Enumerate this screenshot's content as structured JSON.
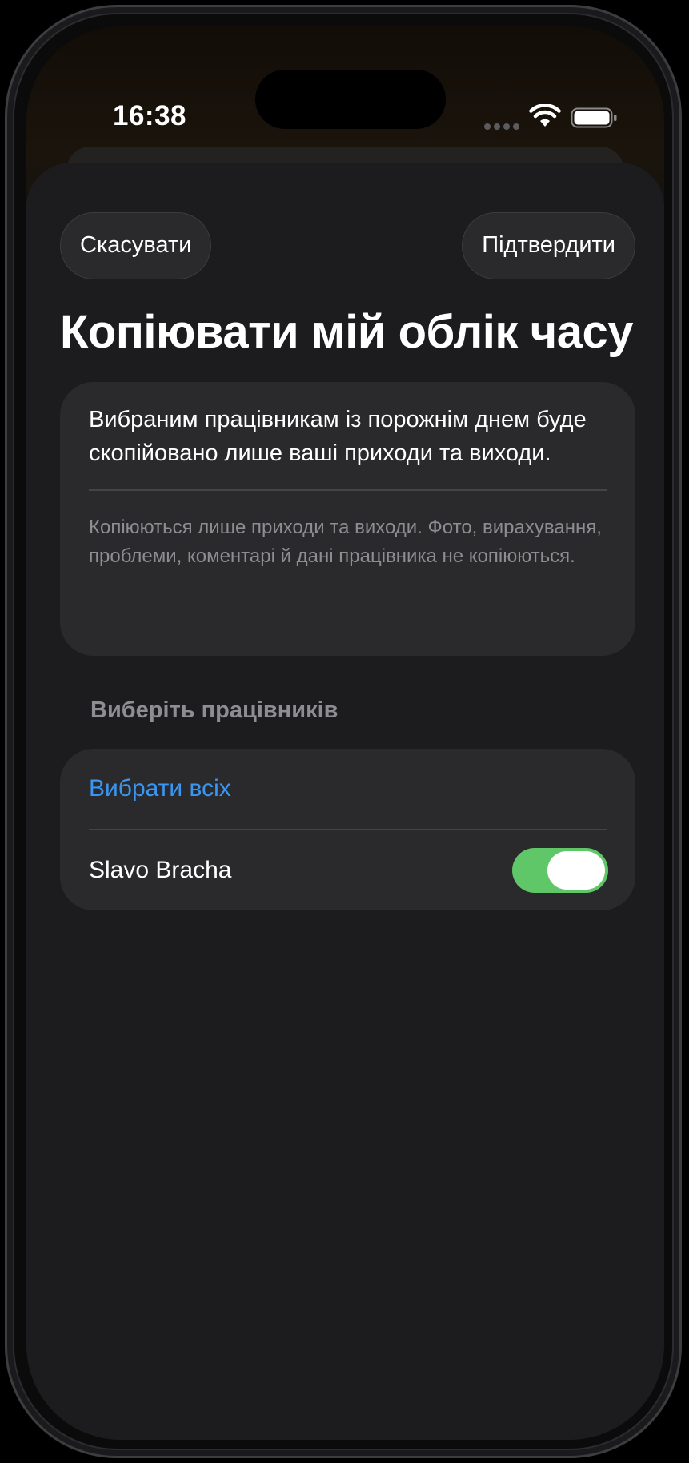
{
  "status_bar": {
    "time": "16:38"
  },
  "toolbar": {
    "cancel_label": "Скасувати",
    "confirm_label": "Підтвердити"
  },
  "page": {
    "title": "Копіювати мій облік часу"
  },
  "info": {
    "main_text": "Вибраним працівникам із порожнім днем буде скопійовано лише ваші приходи та виходи.",
    "note_text": "Копіюються лише приходи та виходи. Фото, вирахування, проблеми, коментарі й дані працівника не копіюються."
  },
  "employees": {
    "section_title": "Виберіть працівників",
    "select_all_label": "Вибрати всіх",
    "items": [
      {
        "name": "Slavo Bracha",
        "selected": true
      }
    ]
  },
  "colors": {
    "accent": "#3a96f2",
    "toggle_on": "#5fc767",
    "sheet_background": "#1c1c1e",
    "card_background": "#2a2a2c"
  },
  "icons": [
    "wifi-icon",
    "battery-icon",
    "cellular-signal-icon"
  ]
}
